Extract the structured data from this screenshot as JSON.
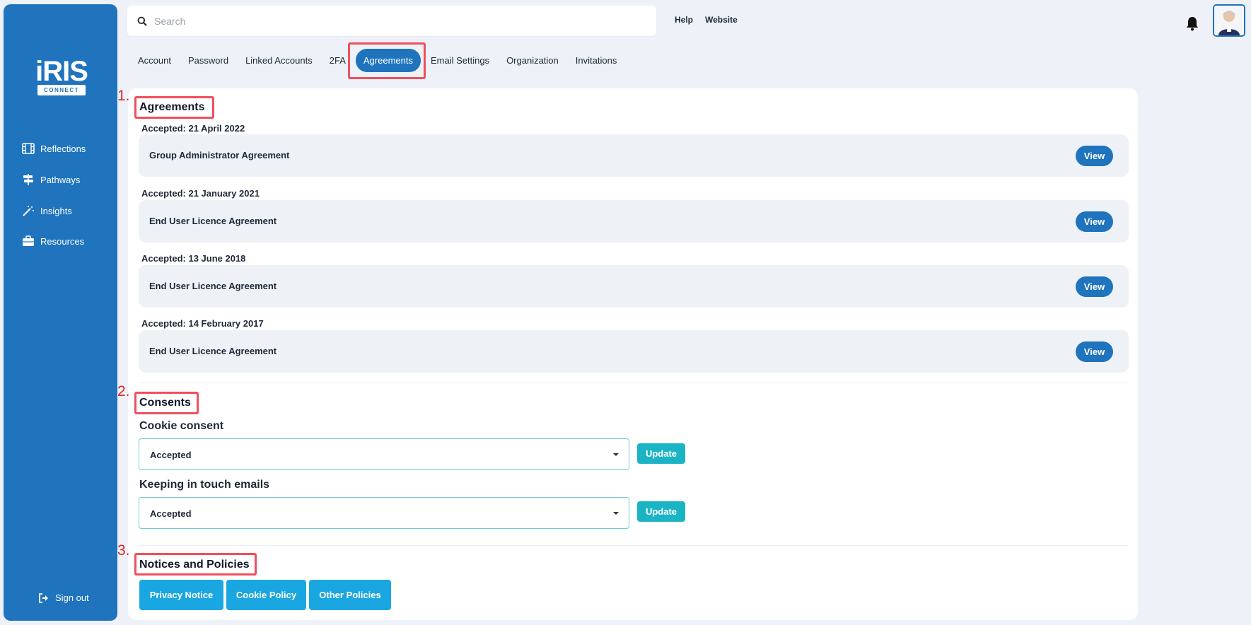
{
  "sidebar": {
    "logo_word": "iRIS",
    "logo_tag": "CONNECT",
    "items": [
      {
        "label": "Reflections",
        "icon": "film-icon"
      },
      {
        "label": "Pathways",
        "icon": "signpost-icon"
      },
      {
        "label": "Insights",
        "icon": "magic-wand-icon"
      },
      {
        "label": "Resources",
        "icon": "briefcase-icon"
      }
    ],
    "signout": "Sign out"
  },
  "header": {
    "search_placeholder": "Search",
    "links": [
      "Help",
      "Website"
    ]
  },
  "tabs": [
    "Account",
    "Password",
    "Linked Accounts",
    "2FA",
    "Agreements",
    "Email Settings",
    "Organization",
    "Invitations"
  ],
  "active_tab": "Agreements",
  "annotations": [
    "1.",
    "2.",
    "3."
  ],
  "agreements": {
    "title": "Agreements",
    "items": [
      {
        "date": "Accepted: 21 April 2022",
        "name": "Group Administrator Agreement",
        "button": "View"
      },
      {
        "date": "Accepted: 21 January 2021",
        "name": "End User Licence Agreement",
        "button": "View"
      },
      {
        "date": "Accepted: 13 June 2018",
        "name": "End User Licence Agreement",
        "button": "View"
      },
      {
        "date": "Accepted: 14 February 2017",
        "name": "End User Licence Agreement",
        "button": "View"
      }
    ]
  },
  "consents": {
    "title": "Consents",
    "items": [
      {
        "label": "Cookie consent",
        "value": "Accepted",
        "button": "Update"
      },
      {
        "label": "Keeping in touch emails",
        "value": "Accepted",
        "button": "Update"
      }
    ]
  },
  "notices": {
    "title": "Notices and Policies",
    "buttons": [
      "Privacy Notice",
      "Cookie Policy",
      "Other Policies"
    ]
  },
  "colors": {
    "sidebar": "#1f74bd",
    "primary": "#1f74bd",
    "teal": "#1bb4c4",
    "policy": "#1aa7e1",
    "highlight": "#f04e5c"
  }
}
